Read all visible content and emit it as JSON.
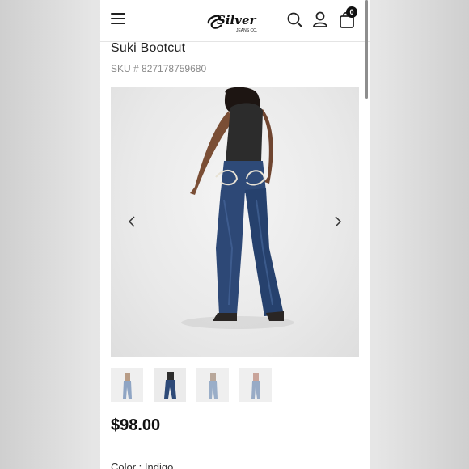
{
  "header": {
    "menu_icon": "hamburger-menu-icon",
    "logo_text": "Silver",
    "logo_subtext": "JEANS CO.",
    "search_icon": "search-icon",
    "account_icon": "user-icon",
    "bag_icon": "shopping-bag-icon",
    "bag_count": "0"
  },
  "product": {
    "title": "Suki Bootcut",
    "sku_label": "SKU #",
    "sku_value": "827178759680",
    "price": "$98.00",
    "color_label": "Color : Indigo"
  },
  "gallery": {
    "prev_icon": "chevron-left-icon",
    "next_icon": "chevron-right-icon",
    "thumbnail_count": 4,
    "selected_thumbnail": 2
  },
  "colors": {
    "denim": "#2e4a78",
    "top": "#2c2c2c",
    "text": "#222222",
    "muted": "#8a8a8a"
  }
}
